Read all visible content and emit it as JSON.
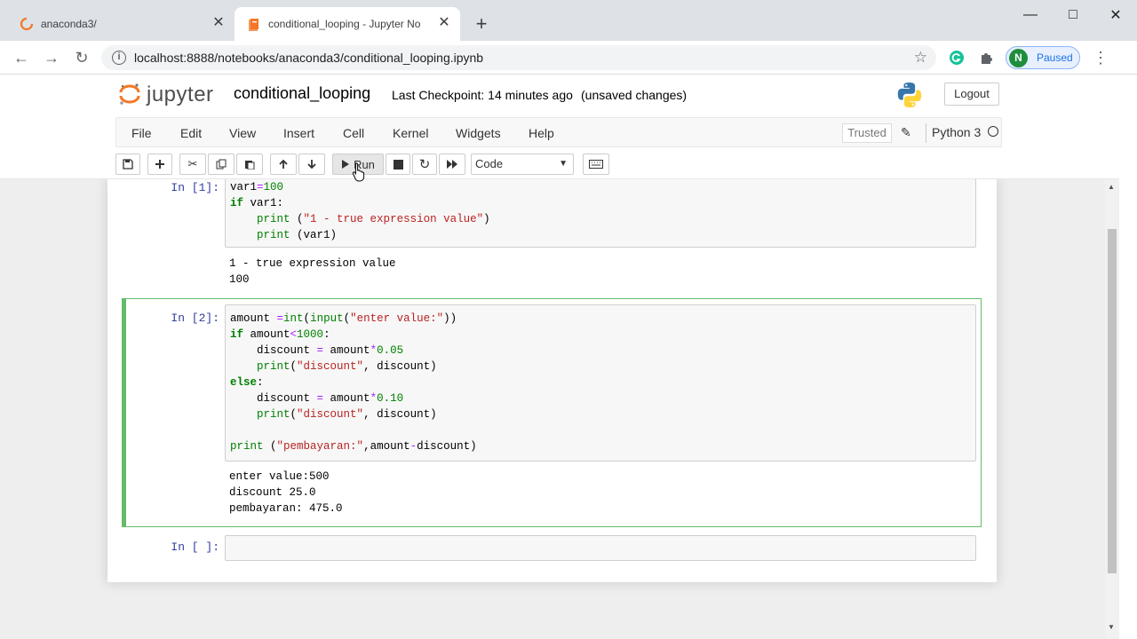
{
  "browser": {
    "tabs": [
      {
        "title": "anaconda3/",
        "active": false
      },
      {
        "title": "conditional_looping - Jupyter No",
        "active": true
      }
    ],
    "url": "localhost:8888/notebooks/anaconda3/conditional_looping.ipynb",
    "profile_initial": "N",
    "profile_status": "Paused"
  },
  "jupyter": {
    "logo_text": "jupyter",
    "notebook_name": "conditional_looping",
    "checkpoint": "Last Checkpoint: 14 minutes ago",
    "unsaved": "(unsaved changes)",
    "logout": "Logout",
    "menu": [
      "File",
      "Edit",
      "View",
      "Insert",
      "Cell",
      "Kernel",
      "Widgets",
      "Help"
    ],
    "trusted": "Trusted",
    "kernel": "Python 3",
    "toolbar": {
      "run_label": "Run",
      "cell_type": "Code"
    }
  },
  "cells": [
    {
      "prompt": "In [1]:",
      "output": [
        "1 - true expression value",
        "100"
      ]
    },
    {
      "prompt": "In [2]:",
      "output": [
        "enter value:500",
        "discount 25.0",
        "pembayaran: 475.0"
      ]
    },
    {
      "prompt": "In [ ]:"
    }
  ],
  "colors": {
    "selected_cell_border": "#66bb6a",
    "prompt": "#303f9f",
    "keyword": "#008000",
    "string": "#ba2121",
    "operator": "#aa22ff"
  }
}
